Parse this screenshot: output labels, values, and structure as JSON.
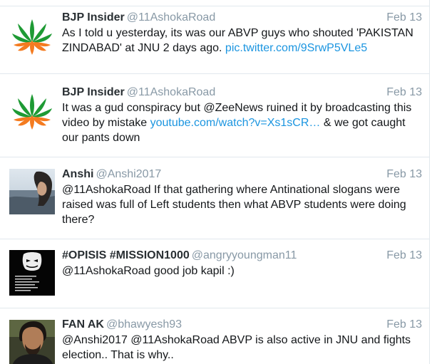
{
  "tweets": [
    {
      "name": "BJP Insider",
      "handle": "@11AshokaRoad",
      "date": "Feb 13",
      "avatar_icon": "lotus-logo",
      "text_before": "As I told u yesterday, its was our ABVP guys who shouted 'PAKISTAN ZINDABAD' at JNU 2 days ago. ",
      "link": "pic.twitter.com/9SrwP5VLe5",
      "text_after": ""
    },
    {
      "name": "BJP Insider",
      "handle": "@11AshokaRoad",
      "date": "Feb 13",
      "avatar_icon": "lotus-logo",
      "text_before": "It was a gud conspiracy but @ZeeNews ruined it by broadcasting this video by mistake ",
      "link": "youtube.com/watch?v=Xs1sCR…",
      "text_after": " & we got caught our pants down"
    },
    {
      "name": "Anshi",
      "handle": "@Anshi2017",
      "date": "Feb 13",
      "avatar_icon": "profile-photo",
      "text_before": "@11AshokaRoad If that gathering where Antinational slogans were raised was full of Left students then what ABVP students were doing there?",
      "link": "",
      "text_after": ""
    },
    {
      "name": "#OPISIS #MISSION1000",
      "handle": "@angryyoungman11",
      "date": "Feb 13",
      "avatar_icon": "anonymous-mask",
      "text_before": "@11AshokaRoad good job kapil :)",
      "link": "",
      "text_after": ""
    },
    {
      "name": "FAN AK",
      "handle": "@bhawyesh93",
      "date": "Feb 13",
      "avatar_icon": "profile-photo",
      "text_before": "@Anshi2017 @11AshokaRoad ABVP is also active in JNU and fights election.. That is why..",
      "link": "",
      "text_after": ""
    }
  ],
  "colors": {
    "name": "#292f33",
    "meta": "#8899a6",
    "link": "#1b95e0",
    "border": "#e1e8ed"
  }
}
